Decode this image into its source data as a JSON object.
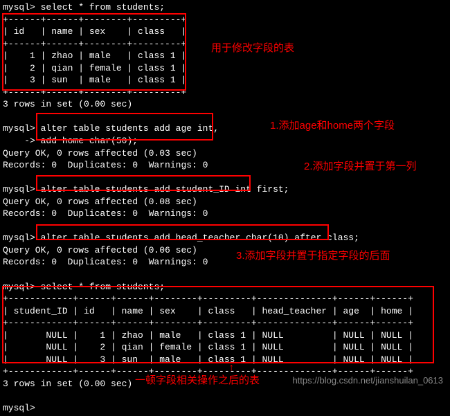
{
  "prompt": "mysql>",
  "cont_prompt": "    ->",
  "queries": {
    "select1": "select * from students;",
    "alter1a": "alter table students add age int,",
    "alter1b": "add home char(50);",
    "alter2": "alter table students add student_ID int first;",
    "alter3": "alter table students add head_teacher char(10) after class;",
    "select2": "select * from students;"
  },
  "responses": {
    "rows_in_set": "3 rows in set (0.00 sec)",
    "q1_ok": "Query OK, 0 rows affected (0.03 sec)",
    "q2_ok": "Query OK, 0 rows affected (0.08 sec)",
    "q3_ok": "Query OK, 0 rows affected (0.06 sec)",
    "records": "Records: 0  Duplicates: 0  Warnings: 0"
  },
  "table1": {
    "border": "+------+------+--------+---------+",
    "header": "| id   | name | sex    | class   |",
    "rows": [
      "|    1 | zhao | male   | class 1 |",
      "|    2 | qian | female | class 1 |",
      "|    3 | sun  | male   | class 1 |"
    ]
  },
  "table2": {
    "border": "+------------+------+------+--------+---------+--------------+------+------+",
    "header": "| student_ID | id   | name | sex    | class   | head_teacher | age  | home |",
    "rows": [
      "|       NULL |    1 | zhao | male   | class 1 | NULL         | NULL | NULL |",
      "|       NULL |    2 | qian | female | class 1 | NULL         | NULL | NULL |",
      "|       NULL |    3 | sun  | male   | class 1 | NULL         | NULL | NULL |"
    ]
  },
  "annotations": {
    "a0": "用于修改字段的表",
    "a1": "1.添加age和home两个字段",
    "a2": "2.添加字段并置于第一列",
    "a3": "3.添加字段并置于指定字段的后面",
    "a4": "一顿字段相关操作之后的表"
  },
  "watermark": "https://blog.csdn.net/jianshuilan_0613",
  "arrow": "↑"
}
